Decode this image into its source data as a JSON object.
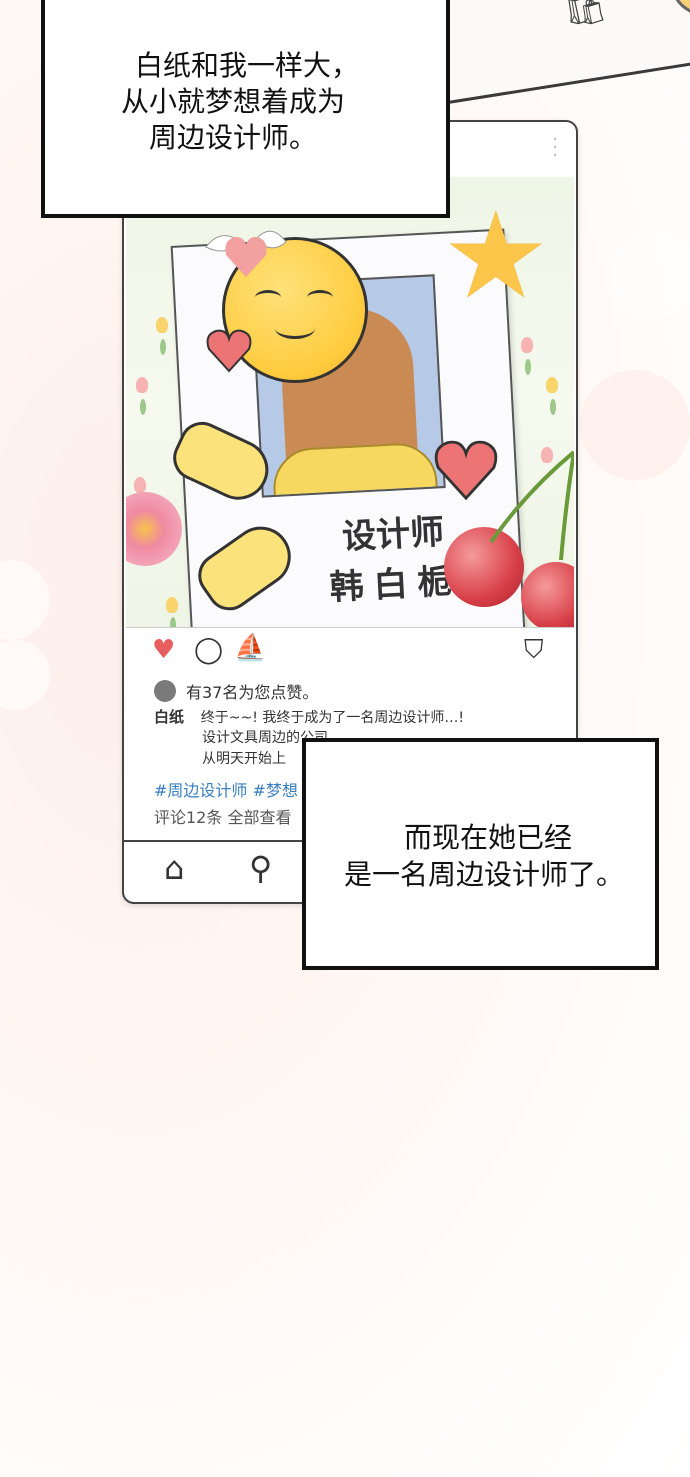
{
  "narration_top": {
    "line1": "白纸和我一样大，",
    "line2": "从小就梦想着成为",
    "line3": "周边设计师。"
  },
  "narration_bottom": {
    "line1": "而现在她已经",
    "line2": "是一名周边设计师了。"
  },
  "post": {
    "card_title": "设计师",
    "card_name": "韩白栀",
    "likes_text": "有37名为您点赞。",
    "username": "白纸",
    "caption_line1": "终于~~! 我终于成为了一名周边设计师…!",
    "caption_line2": "设计文具周边的公司",
    "caption_line3": "从明天开始上",
    "hashtags": "#周边设计师 #梦想",
    "comments_text": "评论12条 全部查看"
  },
  "icons": {
    "like": "heart-icon",
    "comment": "comment-icon",
    "share": "send-icon",
    "bookmark": "bookmark-icon",
    "home": "home-icon",
    "search": "search-icon",
    "add": "add-icon",
    "shop": "shop-bag-icon"
  },
  "colors": {
    "like_heart": "#e85d5d",
    "hashtag": "#3a7fc1",
    "face": "#ffcb3d"
  }
}
